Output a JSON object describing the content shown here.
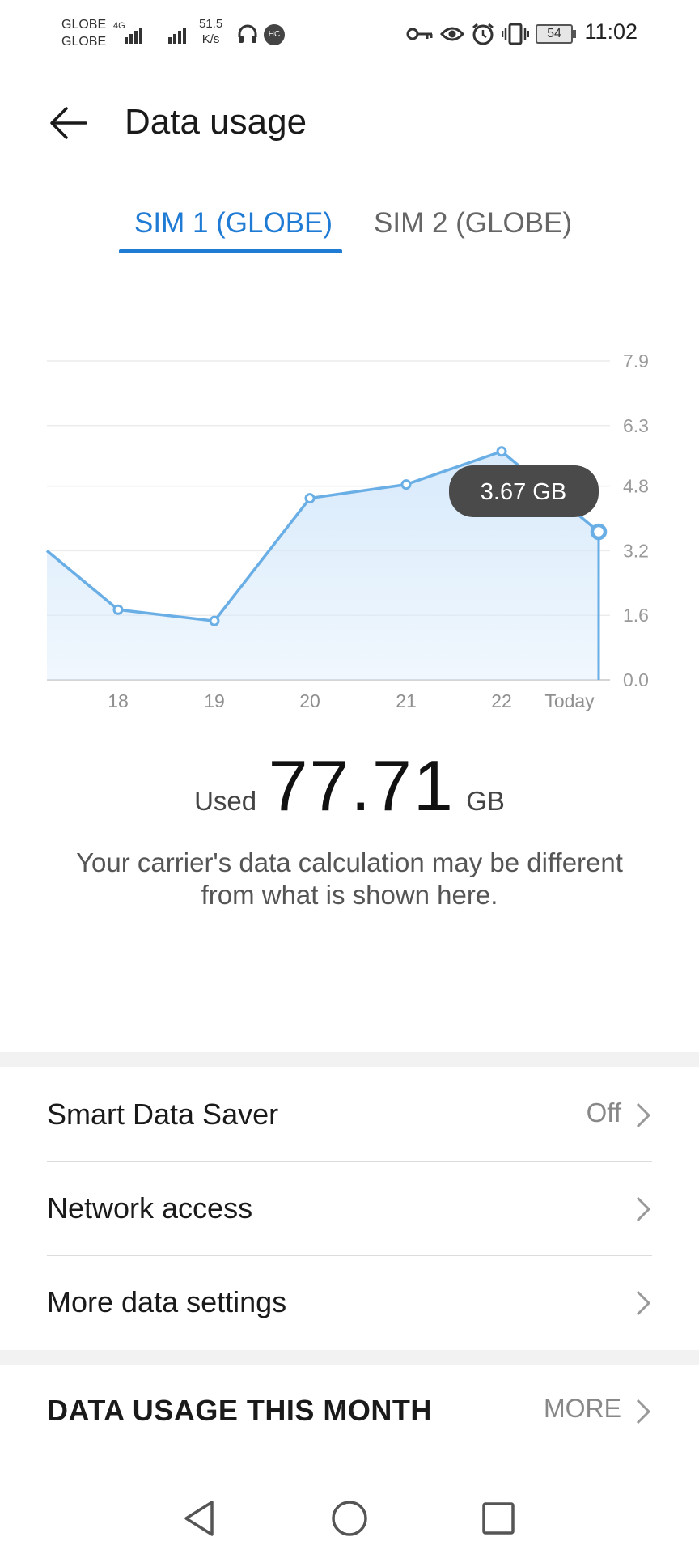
{
  "status_bar": {
    "carrier_1": "GLOBE",
    "carrier_2": "GLOBE",
    "network_type": "4G",
    "speed_value": "51.5",
    "speed_unit": "K/s",
    "hd_badge": "HC",
    "battery_level": "54",
    "time": "11:02",
    "icons": [
      "signal-icon",
      "signal-icon",
      "headphones-icon",
      "key-icon",
      "eye-icon",
      "alarm-icon",
      "vibrate-icon",
      "battery-icon"
    ]
  },
  "header": {
    "back_icon": "arrow-left-icon",
    "title": "Data usage"
  },
  "tabs": [
    {
      "label": "SIM 1 (GLOBE)",
      "active": true
    },
    {
      "label": "SIM 2 (GLOBE)",
      "active": false
    }
  ],
  "chart_data": {
    "type": "area",
    "x": [
      "",
      "18",
      "19",
      "20",
      "21",
      "22",
      "Today"
    ],
    "values": [
      3.2,
      1.74,
      1.46,
      4.5,
      4.84,
      5.66,
      3.67
    ],
    "y_ticks": [
      "7.9",
      "6.3",
      "4.8",
      "3.2",
      "1.6",
      "0.0"
    ],
    "ylim": [
      0,
      7.9
    ],
    "grid": true,
    "tooltip": "3.67 GB",
    "colors": {
      "line": "#6aaee6",
      "fill": "#d6e9fb"
    }
  },
  "usage": {
    "label": "Used",
    "value": "77.71",
    "unit": "GB",
    "note": "Your carrier's data calculation may be different from what is shown here."
  },
  "settings": [
    {
      "label": "Smart Data Saver",
      "value": "Off"
    },
    {
      "label": "Network access",
      "value": ""
    },
    {
      "label": "More data settings",
      "value": ""
    }
  ],
  "monthly": {
    "title": "DATA USAGE THIS MONTH",
    "more_label": "MORE"
  },
  "nav": {
    "icons": [
      "back-triangle-icon",
      "home-circle-icon",
      "recents-square-icon"
    ]
  }
}
